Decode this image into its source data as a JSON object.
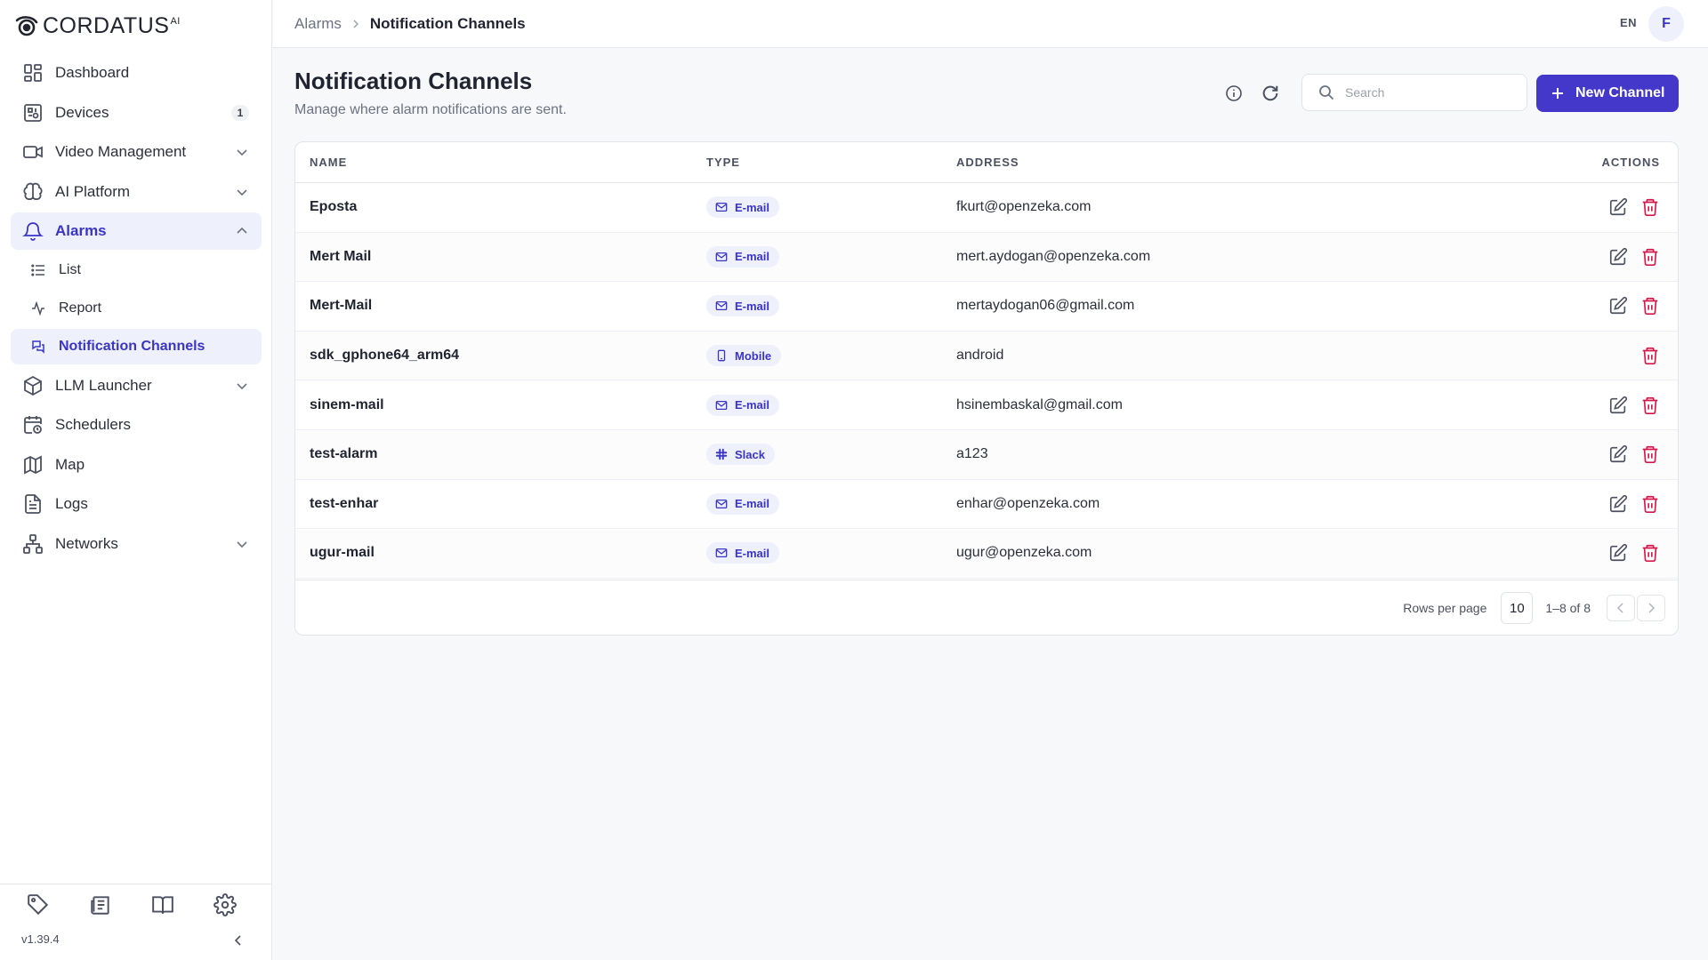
{
  "brand": {
    "name": "CORDATUS",
    "suffix": "AI"
  },
  "sidebar": {
    "items": [
      {
        "label": "Dashboard",
        "icon": "dashboard-icon"
      },
      {
        "label": "Devices",
        "icon": "devices-icon",
        "badge": "1"
      },
      {
        "label": "Video Management",
        "icon": "video-icon"
      },
      {
        "label": "AI Platform",
        "icon": "ai-brain-icon"
      },
      {
        "label": "Alarms",
        "icon": "bell-icon"
      },
      {
        "label": "LLM Launcher",
        "icon": "cube-icon"
      },
      {
        "label": "Schedulers",
        "icon": "calendar-clock-icon"
      },
      {
        "label": "Map",
        "icon": "map-icon"
      },
      {
        "label": "Logs",
        "icon": "file-text-icon"
      },
      {
        "label": "Networks",
        "icon": "network-icon"
      }
    ],
    "alarm_sub": [
      {
        "label": "List",
        "icon": "list-icon"
      },
      {
        "label": "Report",
        "icon": "activity-icon"
      },
      {
        "label": "Notification Channels",
        "icon": "chat-icon"
      }
    ],
    "version": "v1.39.4"
  },
  "topbar": {
    "breadcrumb_parent": "Alarms",
    "breadcrumb_current": "Notification Channels",
    "language": "EN",
    "avatar_initial": "F"
  },
  "page": {
    "title": "Notification Channels",
    "subtitle": "Manage where alarm notifications are sent.",
    "search_placeholder": "Search",
    "new_button": "New Channel"
  },
  "table": {
    "headers": {
      "name": "NAME",
      "type": "TYPE",
      "address": "ADDRESS",
      "actions": "ACTIONS"
    },
    "rows": [
      {
        "name": "Eposta",
        "type": "E-mail",
        "address": "fkurt@openzeka.com"
      },
      {
        "name": "Mert Mail",
        "type": "E-mail",
        "address": "mert.aydogan@openzeka.com"
      },
      {
        "name": "Mert-Mail",
        "type": "E-mail",
        "address": "mertaydogan06@gmail.com"
      },
      {
        "name": "sdk_gphone64_arm64",
        "type": "Mobile",
        "address": "android"
      },
      {
        "name": "sinem-mail",
        "type": "E-mail",
        "address": "hsinembaskal@gmail.com"
      },
      {
        "name": "test-alarm",
        "type": "Slack",
        "address": "a123"
      },
      {
        "name": "test-enhar",
        "type": "E-mail",
        "address": "enhar@openzeka.com"
      },
      {
        "name": "ugur-mail",
        "type": "E-mail",
        "address": "ugur@openzeka.com"
      }
    ]
  },
  "pagination": {
    "rows_per_page_label": "Rows per page",
    "rows_per_page": "10",
    "range": "1–8 of 8"
  },
  "colors": {
    "accent": "#4338ca",
    "accent_soft": "#eef0fb",
    "danger": "#d4184b"
  }
}
